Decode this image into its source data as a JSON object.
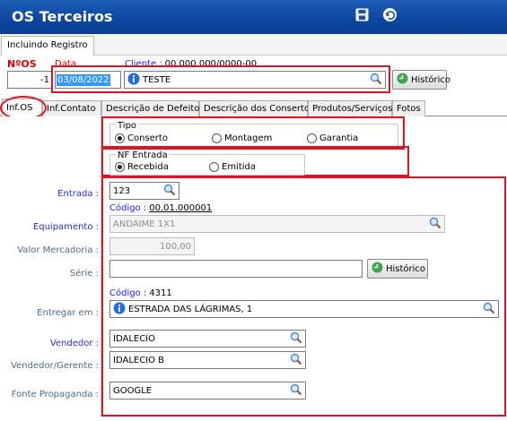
{
  "window": {
    "title": "OS Terceiros"
  },
  "mode_tab": "Incluindo Registro",
  "header": {
    "os_label": "NºOS",
    "data_label": "Data",
    "cliente_label": "Cliente :",
    "cliente_code": "00.000.000/0000-00",
    "os_number": "-1",
    "date_value": "03/08/2022",
    "client_name": "TESTE",
    "historico_label": "Histórico"
  },
  "tabs": [
    {
      "label": "Inf.OS",
      "active": true
    },
    {
      "label": "Inf.Contato"
    },
    {
      "label": "Descrição de Defeitos"
    },
    {
      "label": "Descrição dos Consertos"
    },
    {
      "label": "Produtos/Serviços"
    },
    {
      "label": "Fotos"
    }
  ],
  "tipo": {
    "legend": "Tipo",
    "options": [
      "Conserto",
      "Montagem",
      "Garantia"
    ],
    "selected": "Conserto"
  },
  "nf_entrada": {
    "legend": "NF Entrada",
    "options": [
      "Recebida",
      "Emitida"
    ],
    "selected": "Recebida"
  },
  "form": {
    "entrada_label": "Entrada :",
    "entrada_value": "123",
    "codigo_label": "Código :",
    "equip_code": "00.01.000001",
    "equipamento_label": "Equipamento :",
    "equipamento_value": "ANDAIME 1X1",
    "valor_label": "Valor Mercadoria :",
    "valor_value": "100,00",
    "serie_label": "Série :",
    "serie_value": "",
    "historico_label": "Histórico",
    "entregar_codigo": "4311",
    "entregar_label": "Entregar em :",
    "entregar_value": "ESTRADA DAS LÁGRIMAS, 1",
    "vendedor_label": "Vendedor :",
    "vendedor_value": "IDALECIO",
    "vendedor_gerente_label": "Vendedor/Gerente :",
    "vendedor_gerente_value": "IDALECIO B",
    "fonte_label": "Fonte Propaganda :",
    "fonte_value": "GOOGLE"
  },
  "colors": {
    "titlebar": "#0d47a1",
    "annotation": "#e0141e",
    "label_blue": "#1a1aff"
  }
}
